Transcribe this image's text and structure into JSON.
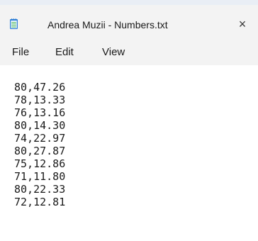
{
  "window": {
    "tab_title": "Andrea Muzii - Numbers.txt",
    "app_icon": "notepad-icon",
    "close_icon": "close-icon",
    "close_glyph": "×"
  },
  "menu": {
    "items": [
      {
        "label": "File"
      },
      {
        "label": "Edit"
      },
      {
        "label": "View"
      }
    ]
  },
  "editor": {
    "lines": [
      "80,47.26",
      "78,13.33",
      "76,13.16",
      "80,14.30",
      "74,22.97",
      "80,27.87",
      "75,12.86",
      "71,11.80",
      "80,22.33",
      "72,12.81"
    ]
  },
  "colors": {
    "titlebar_bg": "#e9eef5",
    "tab_bg": "#f3f3f3",
    "editor_bg": "#ffffff",
    "icon_blue": "#2f7fd6",
    "icon_light": "#e8f4ff",
    "icon_green": "#5bbf5f"
  }
}
